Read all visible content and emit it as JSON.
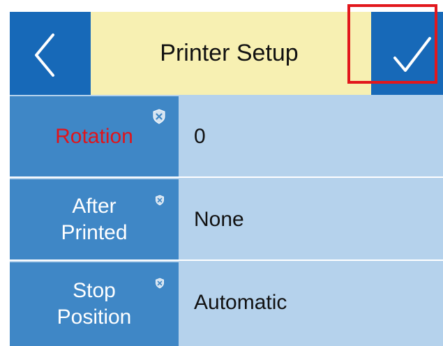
{
  "header": {
    "title": "Printer Setup",
    "back_icon": "chevron-left-icon",
    "confirm_icon": "checkmark-icon"
  },
  "colors": {
    "primary_blue": "#1769b8",
    "label_blue": "#3f87c6",
    "value_bg": "#b5d2ec",
    "header_bg": "#f7f0b2",
    "active_label": "#e0141b",
    "highlight": "#e2171c"
  },
  "settings": [
    {
      "label": "Rotation",
      "value": "0",
      "active": true,
      "clear_icon": "clear-icon"
    },
    {
      "label": "After\nPrinted",
      "value": "None",
      "active": false,
      "clear_icon": "clear-icon"
    },
    {
      "label": "Stop\nPosition",
      "value": "Automatic",
      "active": false,
      "clear_icon": "clear-icon"
    }
  ]
}
